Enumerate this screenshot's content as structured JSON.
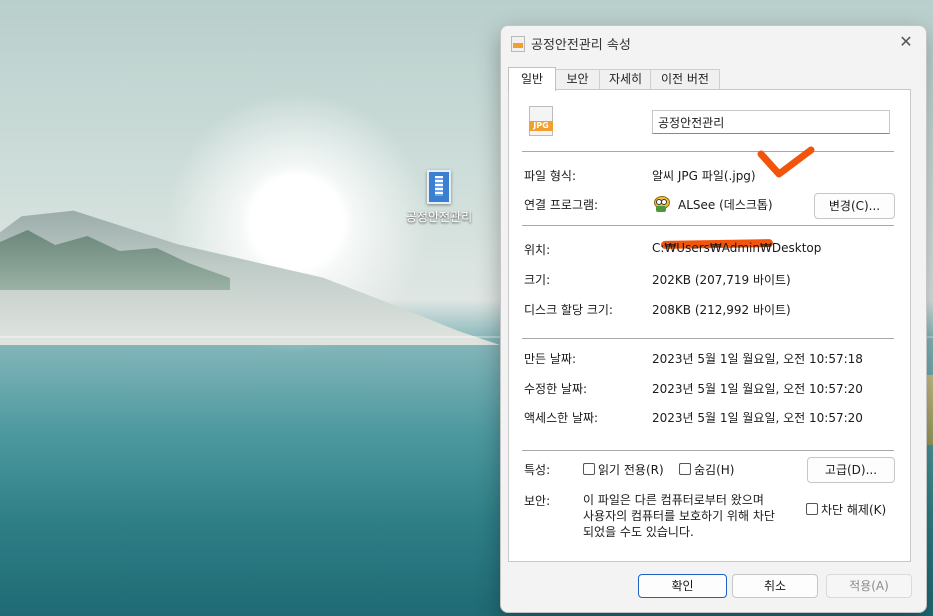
{
  "desktop": {
    "icon_label": "공정안전관리"
  },
  "dialog": {
    "title": "공정안전관리 속성",
    "close_glyph": "✕",
    "tabs": [
      {
        "label": "일반",
        "active": true
      },
      {
        "label": "보안",
        "active": false
      },
      {
        "label": "자세히",
        "active": false
      },
      {
        "label": "이전 버전",
        "active": false
      }
    ],
    "general": {
      "file_icon_badge": "JPG",
      "file_name": "공정안전관리",
      "file_type_label": "파일 형식:",
      "file_type_value": "알씨 JPG 파일(.jpg)",
      "opens_with_label": "연결 프로그램:",
      "opens_with_value": "ALSee (데스크톱)",
      "change_button": "변경(C)...",
      "location_label": "위치:",
      "location_value": "C:₩Users₩Admin₩Desktop",
      "size_label": "크기:",
      "size_value": "202KB (207,719 바이트)",
      "disk_size_label": "디스크 할당 크기:",
      "disk_size_value": "208KB (212,992 바이트)",
      "created_label": "만든 날짜:",
      "created_value": "2023년 5월 1일 월요일, 오전 10:57:18",
      "modified_label": "수정한 날짜:",
      "modified_value": "2023년 5월 1일 월요일, 오전 10:57:20",
      "accessed_label": "액세스한 날짜:",
      "accessed_value": "2023년 5월 1일 월요일, 오전 10:57:20",
      "attributes_label": "특성:",
      "readonly_label": "읽기 전용(R)",
      "readonly_checked": false,
      "hidden_label": "숨김(H)",
      "hidden_checked": false,
      "advanced_button": "고급(D)...",
      "security_label": "보안:",
      "security_line1": "이 파일은 다른 컴퓨터로부터 왔으며",
      "security_line2": "사용자의 컴퓨터를 보호하기 위해 차단",
      "security_line3": "되었을 수도 있습니다.",
      "unblock_label": "차단 해제(K)",
      "unblock_checked": false
    },
    "buttons": {
      "ok": "확인",
      "cancel": "취소",
      "apply": "적용(A)"
    }
  },
  "annotation_color": "#f2540c",
  "accent_color": "#1c62c4"
}
